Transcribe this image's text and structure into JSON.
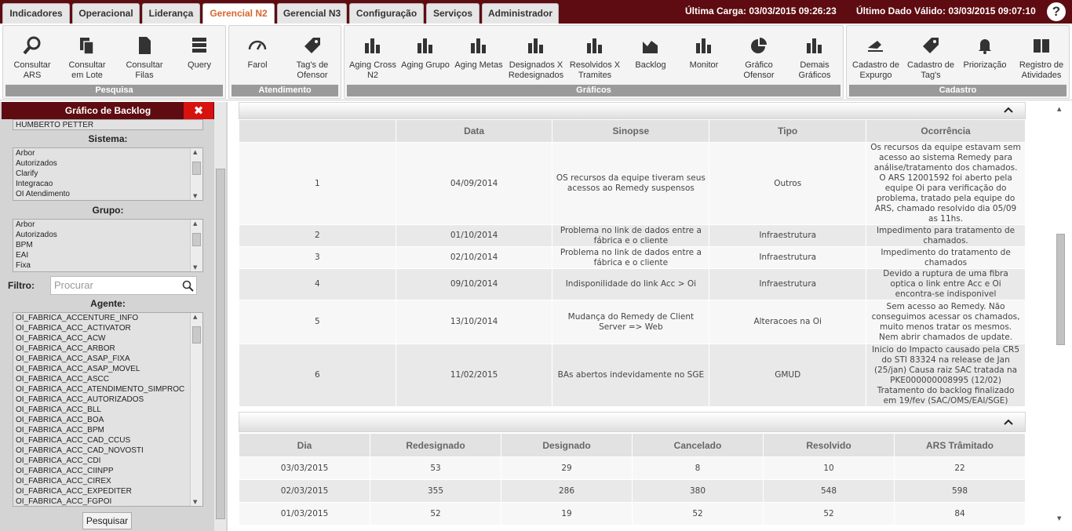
{
  "tabs": [
    {
      "label": "Indicadores",
      "active": false
    },
    {
      "label": "Operacional",
      "active": false
    },
    {
      "label": "Liderança",
      "active": false
    },
    {
      "label": "Gerencial N2",
      "active": true
    },
    {
      "label": "Gerencial N3",
      "active": false
    },
    {
      "label": "Configuração",
      "active": false
    },
    {
      "label": "Serviços",
      "active": false
    },
    {
      "label": "Administrador",
      "active": false
    }
  ],
  "status": {
    "ultima_carga": "Última Carga: 03/03/2015 09:26:23",
    "ultimo_dado": "Último Dado Válido: 03/03/2015 09:07:10",
    "help": "?"
  },
  "toolbar": {
    "pesquisa": {
      "title": "Pesquisa",
      "items": [
        {
          "label": "Consultar ARS",
          "icon": "search-icon"
        },
        {
          "label": "Consultar em Lote",
          "icon": "documents-icon"
        },
        {
          "label": "Consultar Filas",
          "icon": "document-icon"
        },
        {
          "label": "Query",
          "icon": "database-icon"
        }
      ]
    },
    "atendimento": {
      "title": "Atendimento",
      "items": [
        {
          "label": "Farol",
          "icon": "gauge-icon"
        },
        {
          "label": "Tag's de Ofensor",
          "icon": "tag-icon"
        }
      ]
    },
    "graficos": {
      "title": "Gráficos",
      "items": [
        {
          "label": "Aging Cross N2",
          "icon": "bar-chart-icon"
        },
        {
          "label": "Aging Grupo",
          "icon": "bar-chart-icon"
        },
        {
          "label": "Aging Metas",
          "icon": "bar-chart-icon"
        },
        {
          "label": "Designados X Redesignados",
          "icon": "bar-chart-icon"
        },
        {
          "label": "Resolvidos X Tramites",
          "icon": "bar-chart-icon"
        },
        {
          "label": "Backlog",
          "icon": "area-chart-icon"
        },
        {
          "label": "Monitor",
          "icon": "bar-chart-icon"
        },
        {
          "label": "Gráfico Ofensor",
          "icon": "pie-chart-icon"
        },
        {
          "label": "Demais Gráficos",
          "icon": "bar-chart-icon"
        }
      ]
    },
    "cadastro": {
      "title": "Cadastro",
      "items": [
        {
          "label": "Cadastro de Expurgo",
          "icon": "eraser-icon"
        },
        {
          "label": "Cadastro de Tag's",
          "icon": "tag-icon"
        },
        {
          "label": "Priorização",
          "icon": "bell-icon"
        },
        {
          "label": "Registro de Atividades",
          "icon": "book-icon"
        }
      ]
    }
  },
  "left_panel": {
    "title": "Gráfico de Backlog",
    "close": "✖",
    "top_item": "HUMBERTO PETTER",
    "sistema_label": "Sistema:",
    "sistema": [
      "Arbor",
      "Autorizados",
      "Clarify",
      "Integracao",
      "OI Atendimento"
    ],
    "grupo_label": "Grupo:",
    "grupo": [
      "Arbor",
      "Autorizados",
      "BPM",
      "EAI",
      "Fixa"
    ],
    "filtro_label": "Filtro:",
    "filtro_placeholder": "Procurar",
    "agente_label": "Agente:",
    "agente": [
      "OI_FABRICA_ACCENTURE_INFO",
      "OI_FABRICA_ACC_ACTIVATOR",
      "OI_FABRICA_ACC_ACW",
      "OI_FABRICA_ACC_ARBOR",
      "OI_FABRICA_ACC_ASAP_FIXA",
      "OI_FABRICA_ACC_ASAP_MOVEL",
      "OI_FABRICA_ACC_ASCC",
      "OI_FABRICA_ACC_ATENDIMENTO_SIMPROC",
      "OI_FABRICA_ACC_AUTORIZADOS",
      "OI_FABRICA_ACC_BLL",
      "OI_FABRICA_ACC_BOA",
      "OI_FABRICA_ACC_BPM",
      "OI_FABRICA_ACC_CAD_CCUS",
      "OI_FABRICA_ACC_CAD_NOVOSTI",
      "OI_FABRICA_ACC_CDI",
      "OI_FABRICA_ACC_CIINPP",
      "OI_FABRICA_ACC_CIREX",
      "OI_FABRICA_ACC_EXPEDITER",
      "OI_FABRICA_ACC_FGPOI"
    ],
    "button": "Pesquisar"
  },
  "events_table": {
    "columns": [
      "",
      "Data",
      "Sinopse",
      "Tipo",
      "Ocorrência"
    ],
    "rows": [
      [
        "1",
        "04/09/2014",
        "OS recursos da equipe tiveram seus acessos ao Remedy suspensos",
        "Outros",
        "Os recursos da equipe estavam sem acesso ao sistema Remedy para análise/tratamento dos chamados. O ARS 12001592 foi aberto pela equipe Oi para verificação do problema, tratado pela equipe do ARS, chamado resolvido dia 05/09 as 11hs."
      ],
      [
        "2",
        "01/10/2014",
        "Problema no link de dados entre a fábrica e o cliente",
        "Infraestrutura",
        "Impedimento para tratamento de chamados."
      ],
      [
        "3",
        "02/10/2014",
        "Problema no link de dados entre a fábrica e o cliente",
        "Infraestrutura",
        "Impedimento do tratamento de chamados"
      ],
      [
        "4",
        "09/10/2014",
        "Indisponilidade do link Acc > Oi",
        "Infraestrutura",
        "Devido a ruptura de uma fibra optica o link entre Acc e Oi encontra-se indisponivel"
      ],
      [
        "5",
        "13/10/2014",
        "Mudança do Remedy de Client Server => Web",
        "Alteracoes na Oi",
        "Sem acesso ao Remedy. Não conseguimos acessar os chamados, muito menos tratar os mesmos. Nem abrir chamados de update."
      ],
      [
        "6",
        "11/02/2015",
        "BAs abertos indevidamente no SGE",
        "GMUD",
        "Inicio do Impacto causado pela CR5 do STI 83324 na release de Jan (25/jan) Causa raiz SAC tratada na PKE000000008995 (12/02) Tratamento do backlog finalizado em 19/fev (SAC/OMS/EAI/SGE)"
      ]
    ]
  },
  "daily_table": {
    "columns": [
      "Dia",
      "Redesignado",
      "Designado",
      "Cancelado",
      "Resolvido",
      "ARS Trâmitado"
    ],
    "rows": [
      [
        "03/03/2015",
        "53",
        "29",
        "8",
        "10",
        "22"
      ],
      [
        "02/03/2015",
        "355",
        "286",
        "380",
        "548",
        "598"
      ],
      [
        "01/03/2015",
        "52",
        "19",
        "52",
        "52",
        "84"
      ]
    ]
  },
  "colors": {
    "brand": "#5e0c11",
    "active_tab": "#d9662a",
    "close": "#d7120f"
  }
}
